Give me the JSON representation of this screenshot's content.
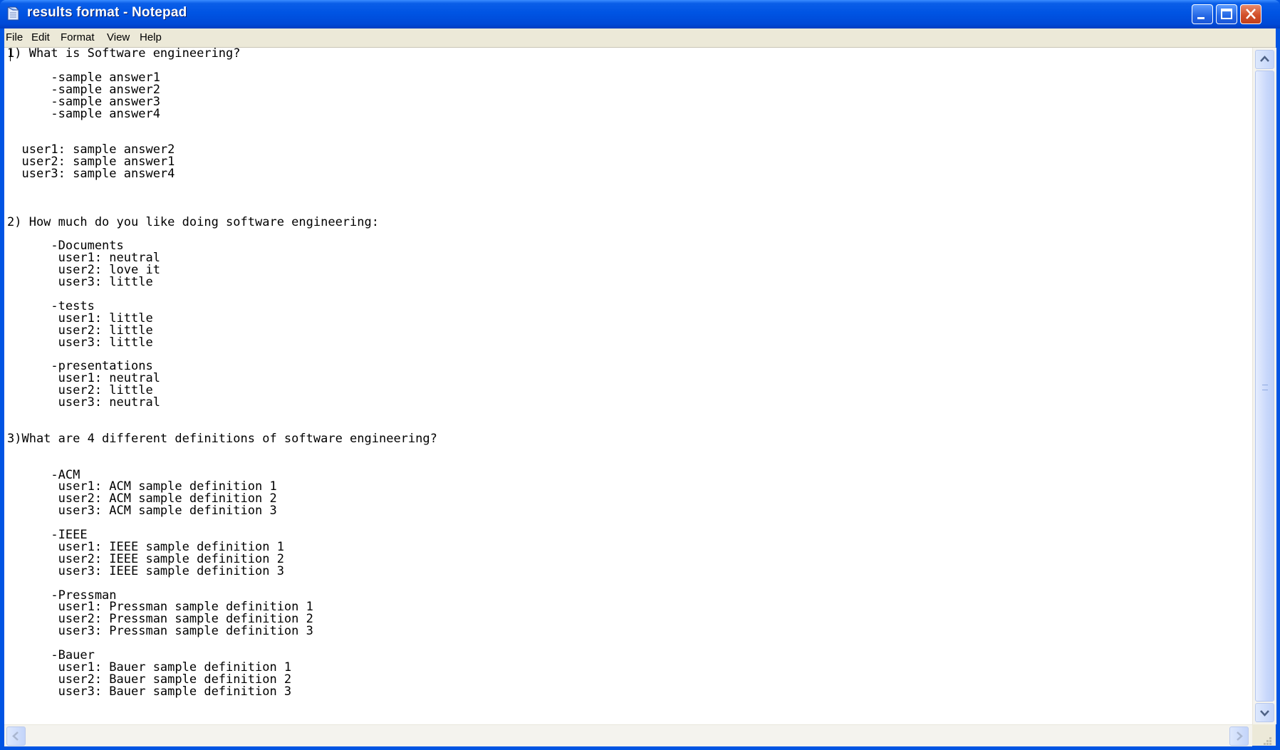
{
  "window": {
    "title": "results format - Notepad",
    "icon": "notepad-icon"
  },
  "title_buttons": {
    "minimize": "minimize-icon",
    "maximize": "maximize-icon",
    "close": "close-icon"
  },
  "menu": {
    "items": [
      "File",
      "Edit",
      "Format",
      "View",
      "Help"
    ]
  },
  "document": {
    "lines": [
      "1) What is Software engineering?",
      "",
      "      -sample answer1",
      "      -sample answer2",
      "      -sample answer3",
      "      -sample answer4",
      "",
      "",
      "  user1: sample answer2",
      "  user2: sample answer1",
      "  user3: sample answer4",
      "",
      "",
      "",
      "2) How much do you like doing software engineering:",
      "",
      "      -Documents",
      "       user1: neutral",
      "       user2: love it",
      "       user3: little",
      "",
      "      -tests",
      "       user1: little",
      "       user2: little",
      "       user3: little",
      "",
      "      -presentations",
      "       user1: neutral",
      "       user2: little",
      "       user3: neutral",
      "",
      "",
      "3)What are 4 different definitions of software engineering?",
      "",
      "",
      "      -ACM",
      "       user1: ACM sample definition 1",
      "       user2: ACM sample definition 2",
      "       user3: ACM sample definition 3",
      "",
      "      -IEEE",
      "       user1: IEEE sample definition 1",
      "       user2: IEEE sample definition 2",
      "       user3: IEEE sample definition 3",
      "",
      "      -Pressman",
      "       user1: Pressman sample definition 1",
      "       user2: Pressman sample definition 2",
      "       user3: Pressman sample definition 3",
      "",
      "      -Bauer",
      "       user1: Bauer sample definition 1",
      "       user2: Bauer sample definition 2",
      "       user3: Bauer sample definition 3"
    ]
  },
  "colors": {
    "titlebar": "#0054e3",
    "menubar": "#ece9d8",
    "editor_bg": "#ffffff",
    "text": "#000000"
  }
}
